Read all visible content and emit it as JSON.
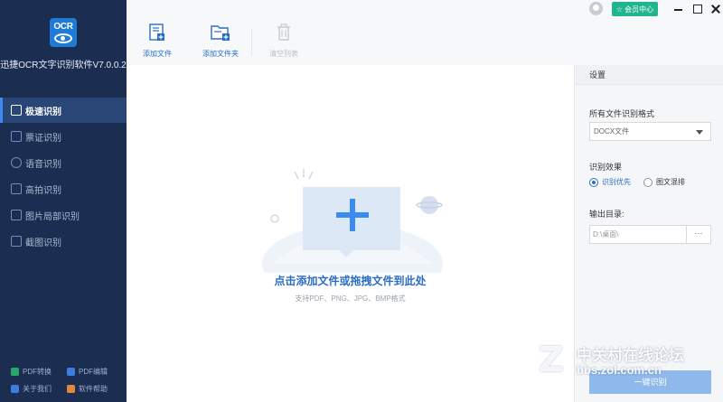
{
  "app": {
    "logo_text": "OCR",
    "title": "迅捷OCR文字识别软件V7.0.0.2"
  },
  "sidebar": {
    "items": [
      {
        "label": "极速识别",
        "icon": "flash-doc-icon",
        "active": true
      },
      {
        "label": "票证识别",
        "icon": "ticket-icon",
        "active": false
      },
      {
        "label": "语音识别",
        "icon": "microphone-icon",
        "active": false
      },
      {
        "label": "高拍识别",
        "icon": "camera-scan-icon",
        "active": false
      },
      {
        "label": "图片局部识别",
        "icon": "image-crop-icon",
        "active": false
      },
      {
        "label": "截图识别",
        "icon": "screenshot-icon",
        "active": false
      }
    ],
    "links": [
      {
        "label": "PDF转换",
        "icon": "pdf-convert-icon",
        "color": "#27a86b"
      },
      {
        "label": "PDF编辑",
        "icon": "pdf-edit-icon",
        "color": "#3c7de0"
      },
      {
        "label": "关于我们",
        "icon": "info-icon",
        "color": "#3c7de0"
      },
      {
        "label": "软件帮助",
        "icon": "help-icon",
        "color": "#e0893c"
      }
    ]
  },
  "toolbar": {
    "add_file": "添加文件",
    "add_folder": "添加文件夹",
    "clear_list": "清空列表"
  },
  "window": {
    "vip_label": "会员中心"
  },
  "main": {
    "drop_title": "点击添加文件或拖拽文件到此处",
    "drop_sub": "支持PDF、PNG、JPG、BMP格式"
  },
  "settings": {
    "header": "设置",
    "format_label": "所有文件识别格式",
    "format_value": "DOCX文件",
    "effect_label": "识别效果",
    "effect_options": [
      "识别优先",
      "图文混排"
    ],
    "effect_selected": "识别优先",
    "output_label": "输出目录:",
    "output_value": "D:\\桌面\\",
    "browse_label": "···",
    "run_label": "一键识别"
  },
  "watermark": {
    "logo_letter": "Z",
    "site_name": "中关村在线论坛",
    "url": "bbs.zol.com.cn"
  },
  "colors": {
    "sidebar_bg": "#1b2e52",
    "accent": "#2a6dc4",
    "vip_green": "#20b58f",
    "run_button": "#8fb8ec"
  }
}
